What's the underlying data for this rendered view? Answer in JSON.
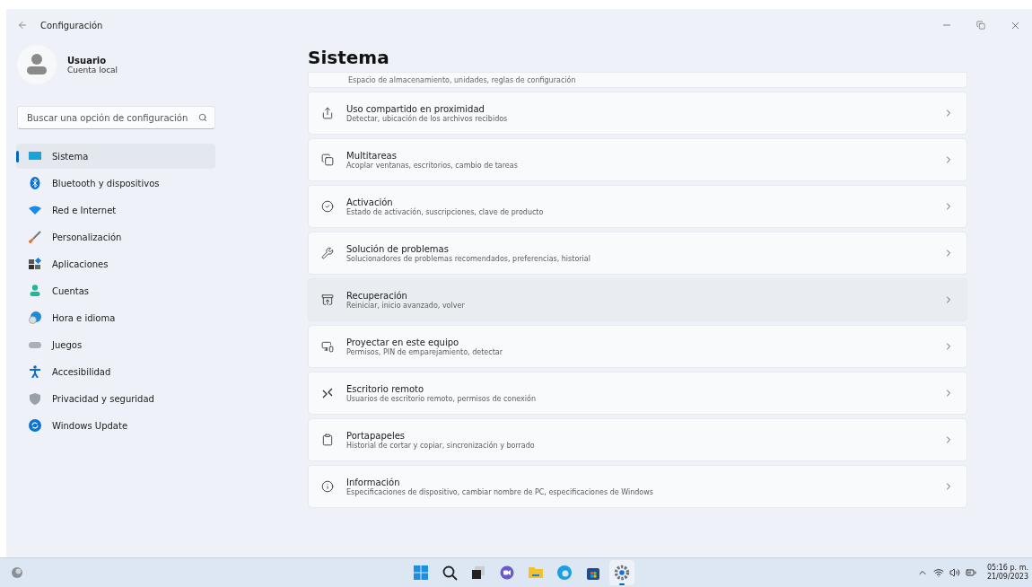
{
  "window": {
    "title": "Configuración"
  },
  "user": {
    "name": "Usuario",
    "account": "Cuenta local"
  },
  "search": {
    "placeholder": "Buscar una opción de configuración"
  },
  "sidebar": {
    "items": [
      {
        "label": "Sistema",
        "selected": true
      },
      {
        "label": "Bluetooth y dispositivos",
        "selected": false
      },
      {
        "label": "Red e Internet",
        "selected": false
      },
      {
        "label": "Personalización",
        "selected": false
      },
      {
        "label": "Aplicaciones",
        "selected": false
      },
      {
        "label": "Cuentas",
        "selected": false
      },
      {
        "label": "Hora e idioma",
        "selected": false
      },
      {
        "label": "Juegos",
        "selected": false
      },
      {
        "label": "Accesibilidad",
        "selected": false
      },
      {
        "label": "Privacidad y seguridad",
        "selected": false
      },
      {
        "label": "Windows Update",
        "selected": false
      }
    ]
  },
  "page": {
    "title": "Sistema",
    "partial_card": {
      "subtitle": "Espacio de almacenamiento, unidades, reglas de configuración"
    },
    "cards": [
      {
        "title": "Uso compartido en proximidad",
        "subtitle": "Detectar, ubicación de los archivos recibidos",
        "hovered": false
      },
      {
        "title": "Multitareas",
        "subtitle": "Acoplar ventanas, escritorios, cambio de tareas",
        "hovered": false
      },
      {
        "title": "Activación",
        "subtitle": "Estado de activación, suscripciones, clave de producto",
        "hovered": false
      },
      {
        "title": "Solución de problemas",
        "subtitle": "Solucionadores de problemas recomendados, preferencias, historial",
        "hovered": false
      },
      {
        "title": "Recuperación",
        "subtitle": "Reiniciar, inicio avanzado, volver",
        "hovered": true
      },
      {
        "title": "Proyectar en este equipo",
        "subtitle": "Permisos, PIN de emparejamiento, detectar",
        "hovered": false
      },
      {
        "title": "Escritorio remoto",
        "subtitle": "Usuarios de escritorio remoto, permisos de conexión",
        "hovered": false
      },
      {
        "title": "Portapapeles",
        "subtitle": "Historial de cortar y copiar, sincronización y borrado",
        "hovered": false
      },
      {
        "title": "Información",
        "subtitle": "Especificaciones de dispositivo, cambiar nombre de PC, especificaciones de Windows",
        "hovered": false
      }
    ]
  },
  "taskbar": {
    "apps": [
      {
        "selected": false
      },
      {
        "selected": false
      },
      {
        "selected": false
      },
      {
        "selected": false
      },
      {
        "selected": false
      },
      {
        "selected": false
      },
      {
        "selected": false
      },
      {
        "selected": true
      }
    ],
    "time": "05:16 p. m.",
    "date": "21/09/2023"
  }
}
